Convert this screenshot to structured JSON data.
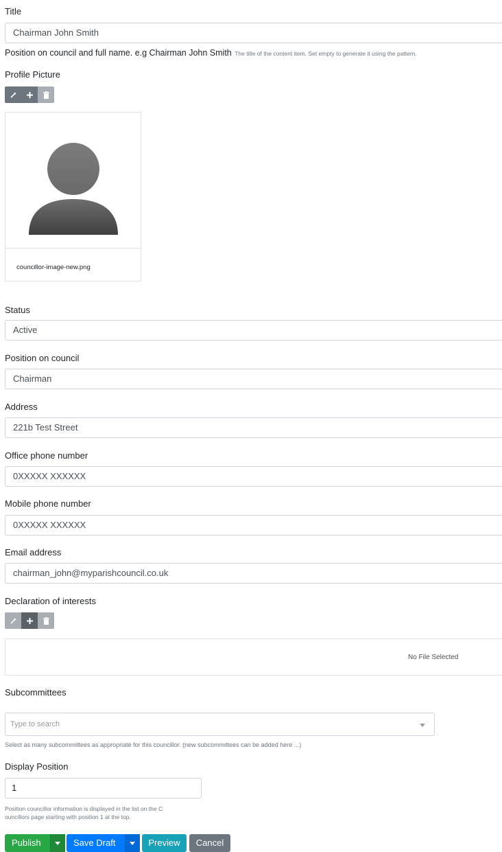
{
  "title": {
    "label": "Title",
    "value": "Chairman John Smith",
    "hint_main": "Position on council and full name. e.g Chairman John Smith",
    "hint_extra": "The title of the content item. Set empty to generate it using the pattern."
  },
  "profile_picture": {
    "label": "Profile Picture",
    "filename": "councillor-image-new.png",
    "toolbar": {
      "edit_icon": "edit-icon",
      "add_icon": "plus-icon",
      "delete_icon": "trash-icon"
    }
  },
  "status": {
    "label": "Status",
    "value": "Active"
  },
  "position": {
    "label": "Position on council",
    "value": "Chairman"
  },
  "address": {
    "label": "Address",
    "value": "221b Test Street"
  },
  "office_phone": {
    "label": "Office phone number",
    "value": "0XXXXX XXXXXX"
  },
  "mobile_phone": {
    "label": "Mobile phone number",
    "value": "0XXXXX XXXXXX"
  },
  "email": {
    "label": "Email address",
    "value": "chairman_john@myparishcouncil.co.uk"
  },
  "declaration": {
    "label": "Declaration of interests",
    "empty_text": "No File Selected"
  },
  "subcommittees": {
    "label": "Subcommittees",
    "placeholder": "Type to search",
    "hint": "Select as many subcommittees as appropriate for this councillor. (new subcommittees can be added here ...)"
  },
  "display_position": {
    "label": "Display Position",
    "value": "1",
    "hint_line1": "Position councillor information is displayed in the list on the C",
    "hint_line2": "ouncillors page starting with position 1 at the top."
  },
  "actions": {
    "publish": "Publish",
    "save_draft": "Save Draft",
    "preview": "Preview",
    "cancel": "Cancel"
  },
  "colors": {
    "publish": "#28a745",
    "save_draft": "#007bff",
    "preview": "#17a2b8",
    "cancel": "#6c757d"
  }
}
